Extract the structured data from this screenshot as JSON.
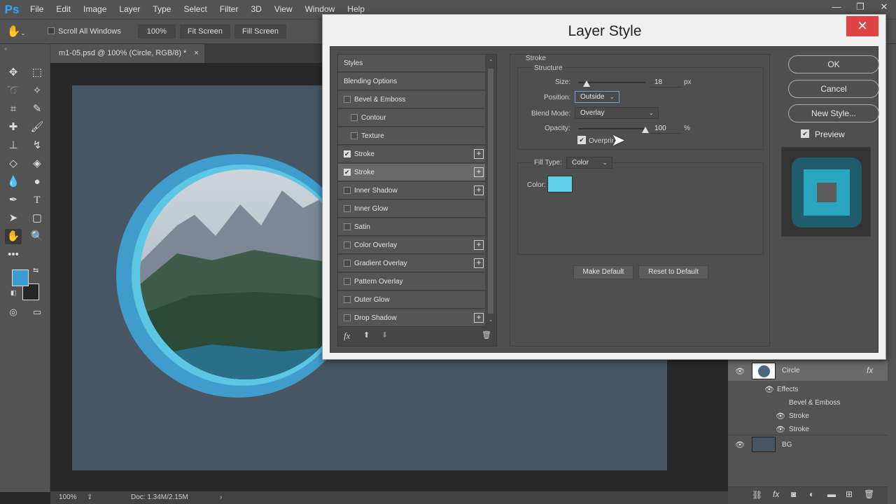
{
  "app": {
    "logo": "Ps"
  },
  "menu": [
    "File",
    "Edit",
    "Image",
    "Layer",
    "Type",
    "Select",
    "Filter",
    "3D",
    "View",
    "Window",
    "Help"
  ],
  "window_controls": {
    "minimize": "—",
    "restore": "❐",
    "close": "✕"
  },
  "options_bar": {
    "scroll_all": "Scroll All Windows",
    "zoom": "100%",
    "fit_screen": "Fit Screen",
    "fill_screen": "Fill Screen"
  },
  "document": {
    "tab_title": "m1-05.psd @ 100% (Circle, RGB/8) *",
    "tab_close": "×"
  },
  "status": {
    "zoom": "100%",
    "doc": "Doc: 1.34M/2.15M",
    "arrow": "›"
  },
  "colors": {
    "foreground": "#3a9bd0",
    "background": "#262626",
    "canvas": "#475662",
    "stroke_color": "#5bd0e8"
  },
  "dialog": {
    "title": "Layer Style",
    "close": "✕",
    "styles": [
      {
        "label": "Styles",
        "checkbox": false,
        "indent": 0,
        "plus": false,
        "checked": false
      },
      {
        "label": "Blending Options",
        "checkbox": false,
        "indent": 0,
        "plus": false,
        "checked": false
      },
      {
        "label": "Bevel & Emboss",
        "checkbox": true,
        "indent": 0,
        "plus": false,
        "checked": false
      },
      {
        "label": "Contour",
        "checkbox": true,
        "indent": 1,
        "plus": false,
        "checked": false
      },
      {
        "label": "Texture",
        "checkbox": true,
        "indent": 1,
        "plus": false,
        "checked": false
      },
      {
        "label": "Stroke",
        "checkbox": true,
        "indent": 0,
        "plus": true,
        "checked": true
      },
      {
        "label": "Stroke",
        "checkbox": true,
        "indent": 0,
        "plus": true,
        "checked": true,
        "selected": true
      },
      {
        "label": "Inner Shadow",
        "checkbox": true,
        "indent": 0,
        "plus": true,
        "checked": false
      },
      {
        "label": "Inner Glow",
        "checkbox": true,
        "indent": 0,
        "plus": false,
        "checked": false
      },
      {
        "label": "Satin",
        "checkbox": true,
        "indent": 0,
        "plus": false,
        "checked": false
      },
      {
        "label": "Color Overlay",
        "checkbox": true,
        "indent": 0,
        "plus": true,
        "checked": false
      },
      {
        "label": "Gradient Overlay",
        "checkbox": true,
        "indent": 0,
        "plus": true,
        "checked": false
      },
      {
        "label": "Pattern Overlay",
        "checkbox": true,
        "indent": 0,
        "plus": false,
        "checked": false
      },
      {
        "label": "Outer Glow",
        "checkbox": true,
        "indent": 0,
        "plus": false,
        "checked": false
      },
      {
        "label": "Drop Shadow",
        "checkbox": true,
        "indent": 0,
        "plus": true,
        "checked": false
      }
    ],
    "list_bottom": {
      "fx": "fx",
      "up": "⬆",
      "down": "⬇",
      "trash": "🗑"
    },
    "stroke": {
      "section": "Stroke",
      "structure": "Structure",
      "size_label": "Size:",
      "size_value": "18",
      "size_unit": "px",
      "size_fraction": 0.12,
      "position_label": "Position:",
      "position_value": "Outside",
      "blend_label": "Blend Mode:",
      "blend_value": "Overlay",
      "opacity_label": "Opacity:",
      "opacity_value": "100",
      "opacity_unit": "%",
      "opacity_fraction": 1.0,
      "overprint_label": "Overprint",
      "fill_type_label": "Fill Type:",
      "fill_type_value": "Color",
      "color_label": "Color:",
      "make_default": "Make Default",
      "reset_default": "Reset to Default"
    },
    "buttons": {
      "ok": "OK",
      "cancel": "Cancel",
      "new_style": "New Style...",
      "preview": "Preview"
    }
  },
  "layers": {
    "circle": "Circle",
    "fx": "fx",
    "effects": "Effects",
    "effect_items": [
      "Bevel & Emboss",
      "Stroke",
      "Stroke"
    ],
    "bg": "BG"
  }
}
